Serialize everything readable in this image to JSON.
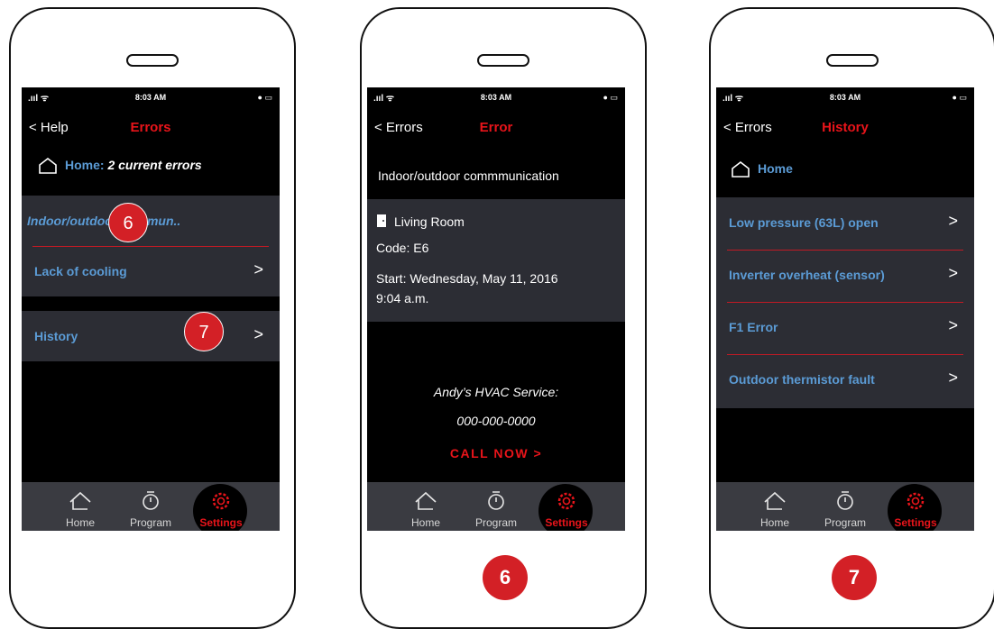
{
  "status": {
    "time": "8:03 AM",
    "signal": ".ııl ᯤ",
    "battery": "● ▭"
  },
  "screen1": {
    "back": "< Help",
    "title": "Errors",
    "home_label": "Home:",
    "home_count": "2 current errors",
    "errors": [
      "Indoor/outdoor commun..",
      "Lack of cooling"
    ],
    "history_label": "History",
    "badge_6": "6",
    "badge_7": "7"
  },
  "screen2": {
    "back": "< Errors",
    "title": "Error",
    "error_name": "Indoor/outdoor commmunication",
    "room": "Living Room",
    "code": "Code: E6",
    "start": "Start: Wednesday, May 11, 2016",
    "start_time": "9:04 a.m.",
    "service_name": "Andy’s HVAC Service:",
    "service_phone": "000-000-0000",
    "call_now": "CALL NOW  >",
    "below_badge": "6"
  },
  "screen3": {
    "back": "< Errors",
    "title": "History",
    "home_label": "Home",
    "items": [
      "Low pressure (63L) open",
      "Inverter overheat (sensor)",
      "F1 Error",
      "Outdoor thermistor fault"
    ],
    "below_badge": "7"
  },
  "tabs": [
    "Home",
    "Program",
    "Settings"
  ],
  "colors": {
    "accent_red": "#e8141a",
    "link_blue": "#5b9bd5",
    "panel": "#2c2d34",
    "tabbar": "#3a3b41"
  },
  "icons": [
    "house-icon",
    "timer-icon",
    "gear-icon",
    "door-icon",
    "chevron-right-icon"
  ]
}
